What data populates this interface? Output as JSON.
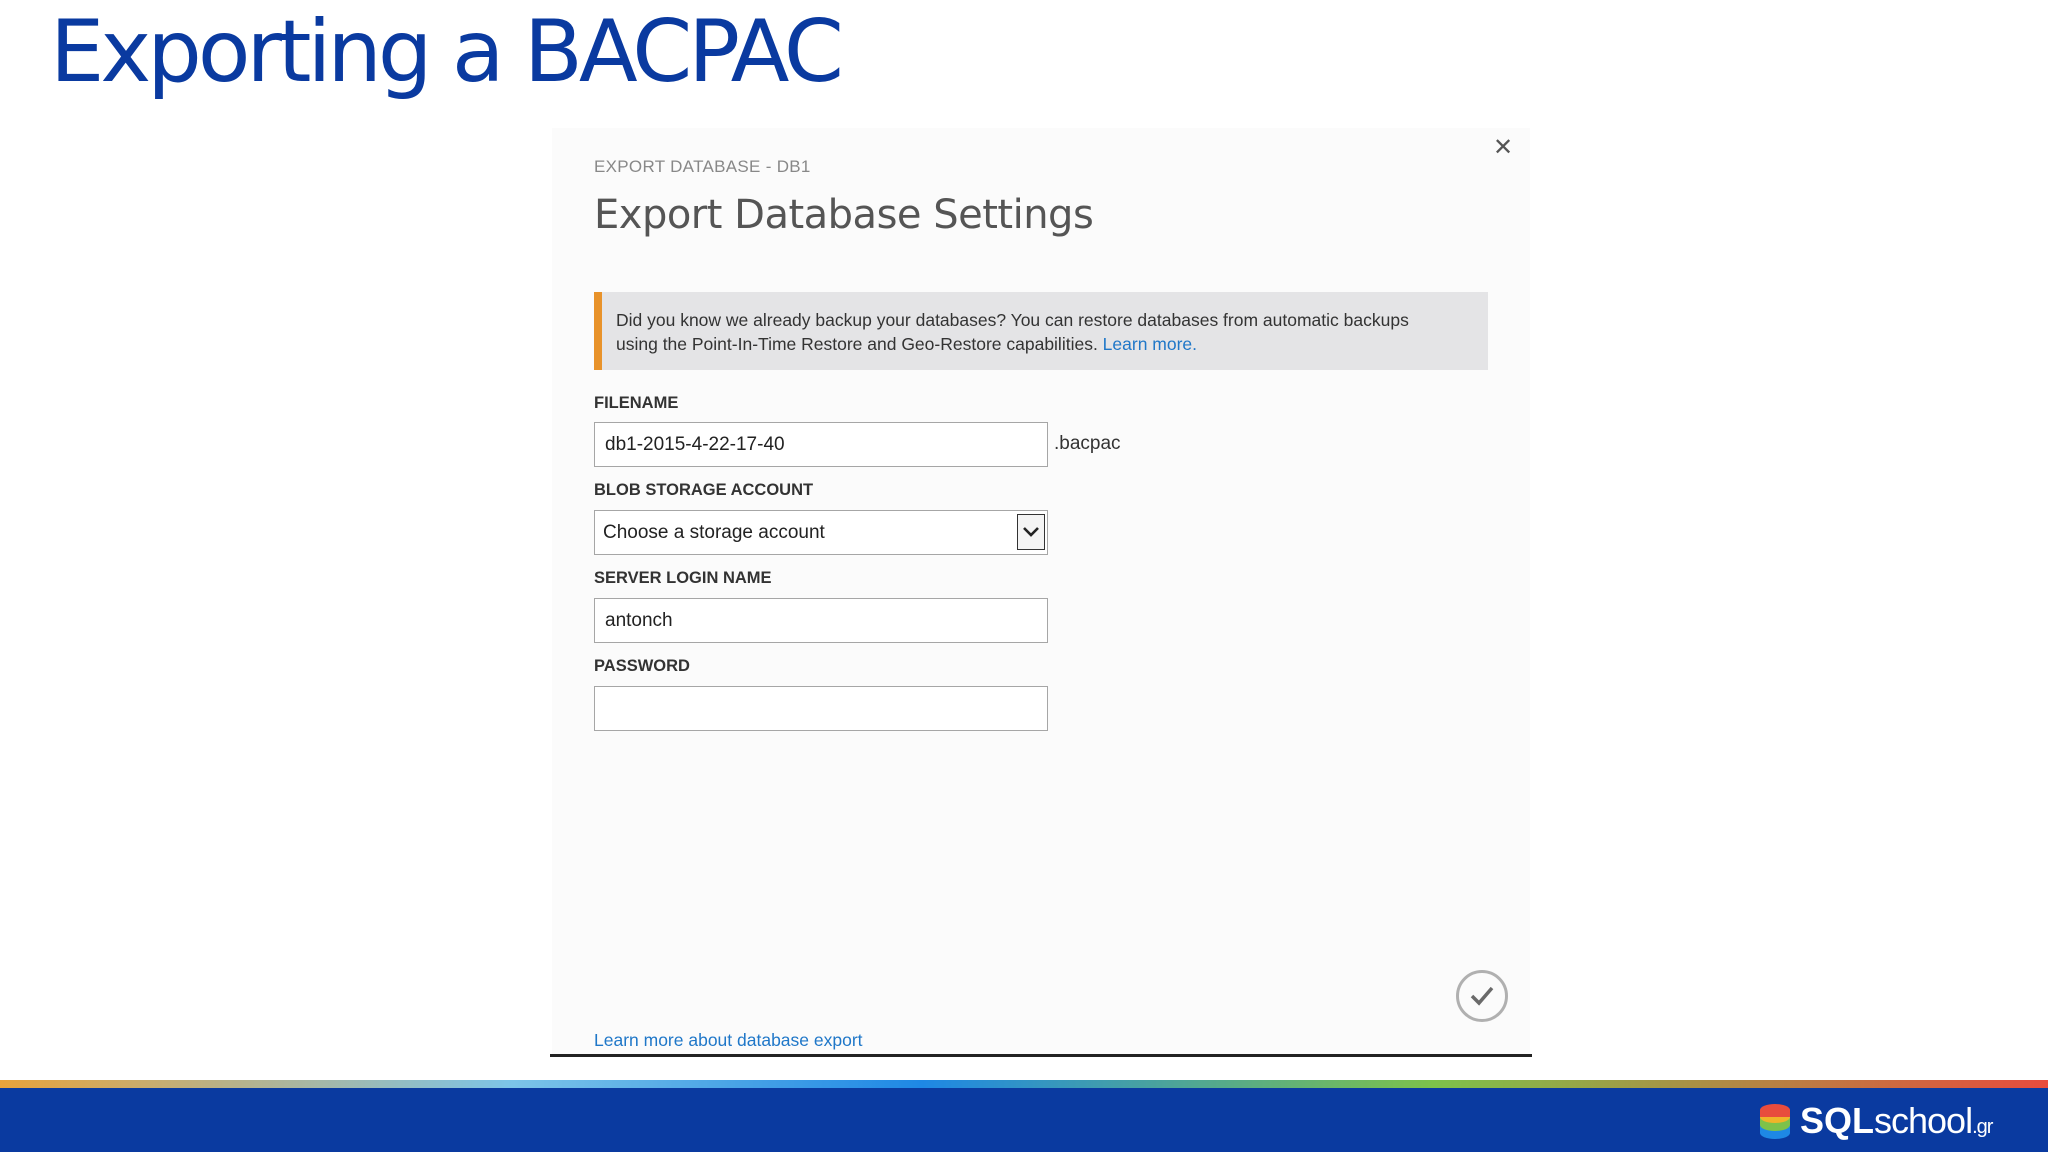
{
  "slide": {
    "title": "Exporting a BACPAC"
  },
  "dialog": {
    "overline": "EXPORT DATABASE - DB1",
    "heading": "Export Database Settings",
    "close_icon": "close-icon",
    "notice": {
      "line1": "Did you know we already backup your databases? You can restore databases from automatic backups",
      "line2": "using the Point-In-Time Restore and Geo-Restore capabilities. ",
      "link": "Learn more.",
      "accent_color": "#e8922a"
    },
    "filename": {
      "label": "FILENAME",
      "value": "db1-2015-4-22-17-40",
      "suffix": ".bacpac"
    },
    "blob_storage": {
      "label": "BLOB STORAGE ACCOUNT",
      "selected": "Choose a storage account",
      "icon": "chevron-down-icon"
    },
    "server_login": {
      "label": "SERVER LOGIN NAME",
      "value": "antonch"
    },
    "password": {
      "label": "PASSWORD",
      "value": ""
    },
    "confirm_icon": "checkmark-icon",
    "footer_link": "Learn more about database export"
  },
  "branding": {
    "logo_bold": "SQL",
    "logo_light": "school",
    "logo_suffix": ".gr",
    "bar_color": "#0a3aa0"
  }
}
